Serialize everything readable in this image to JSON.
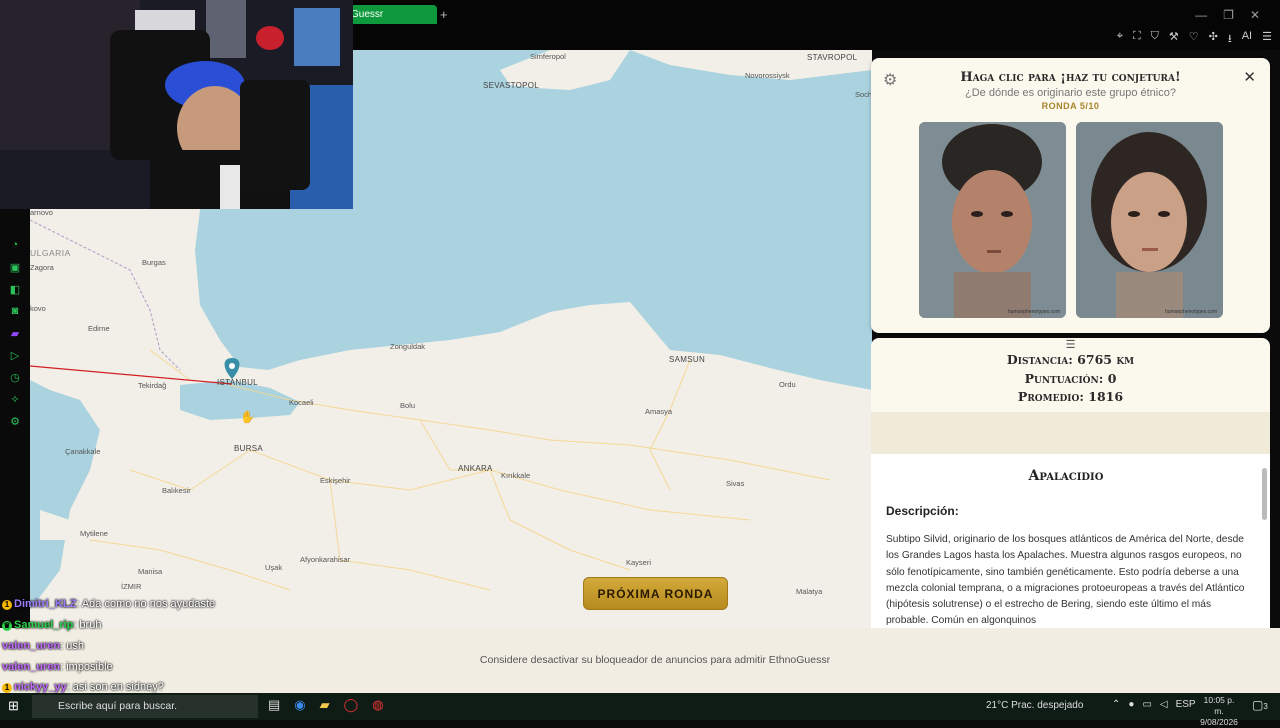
{
  "browser": {
    "tab_label": "Guessr",
    "new_tab": "+",
    "extension_label": "AI"
  },
  "map": {
    "next_round_label": "PRÓXIMA RONDA",
    "country_labels": [
      "ULGARIA"
    ],
    "cities": [
      "Simferopol",
      "SEVASTOPOL",
      "Novorossiysk",
      "Sochi",
      "STAVROPOL",
      "arnovo",
      "Burgas",
      "Zagora",
      "kovo",
      "Edirne",
      "Tekirdağ",
      "ISTANBUL",
      "Kocaeli",
      "Zonguldak",
      "SAMSUN",
      "Ordu",
      "Bolu",
      "Amasya",
      "BURSA",
      "Çanakkale",
      "Balıkesir",
      "Eskişehir",
      "ANKARA",
      "Kırıkkale",
      "Sivas",
      "Mytilene",
      "Afyonkarahisar",
      "Manisa",
      "Uşak",
      "Kayseri",
      "İZMIR",
      "Malatya"
    ]
  },
  "quiz": {
    "title": "Haga clic para ¡haz tu conjetura!",
    "subtitle": "¿De dónde es originario este grupo étnico?",
    "round": "RONDA 5/10",
    "photo_captions": [
      "humanphenotypes.com",
      "humanphenotypes.com"
    ]
  },
  "result": {
    "handle": "☰",
    "distance": "Distancia: 6765 km",
    "score": "Puntuación: 0",
    "average": "Promedio: 1816"
  },
  "description": {
    "title": "Apalacidio",
    "label": "Descripción:",
    "body": "Subtipo Silvid, originario de los bosques atlánticos de América del Norte, desde los Grandes Lagos hasta los Apalaches. Muestra algunos rasgos europeos, no sólo fenotípicamente, sino también genéticamente. Esto podría deberse a una mezcla colonial temprana, o a migraciones protoeuropeas a través del Atlántico (hipótesis solutrense) o el estrecho de Bering, siendo este último el más probable. Común en algonquinos"
  },
  "footer": {
    "notice": "Considere desactivar su bloqueador de anuncios para admitir EthnoGuessr"
  },
  "chat": [
    {
      "user": "Dimitri_KLZ",
      "message": ": Ada como no nos ayudaste",
      "color": "#9d7cff",
      "badge": "1"
    },
    {
      "user": "Samuel_rip",
      "message": ": bruh",
      "color": "#2bd24b",
      "badge": "♛"
    },
    {
      "user": "valen_uren",
      "message": ": ush",
      "color": "#c16bff",
      "badge": ""
    },
    {
      "user": "valen_uren",
      "message": ": imposible",
      "color": "#c16bff",
      "badge": ""
    },
    {
      "user": "nickyy_yy",
      "message": ": asi son en sidney?",
      "color": "#c16bff",
      "badge": "1"
    }
  ],
  "taskbar": {
    "search_placeholder": "Escribe aquí para buscar.",
    "weather": "21°C  Prac. despejado",
    "lang": "ESP",
    "time": "10:05 p. m.",
    "date": "9/08/2026",
    "notif_count": "3"
  }
}
